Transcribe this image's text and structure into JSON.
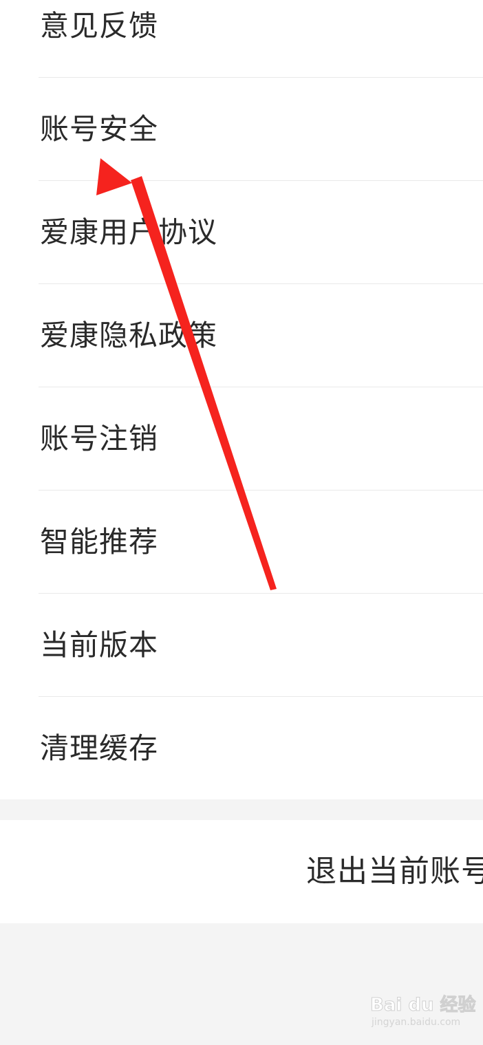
{
  "settings": {
    "items": [
      {
        "label": "意见反馈"
      },
      {
        "label": "账号安全"
      },
      {
        "label": "爱康用户协议"
      },
      {
        "label": "爱康隐私政策"
      },
      {
        "label": "账号注销"
      },
      {
        "label": "智能推荐"
      },
      {
        "label": "当前版本"
      },
      {
        "label": "清理缓存"
      }
    ]
  },
  "logout": {
    "label": "退出当前账号"
  },
  "annotation": {
    "arrow_icon": "red-arrow-icon",
    "color": "#f5231e"
  },
  "watermark": {
    "logo": "Bai du 经验",
    "sub": "jingyan.baidu.com"
  },
  "colors": {
    "background": "#f5f5f5",
    "panel": "#ffffff",
    "text": "#2a2a2a",
    "divider": "#e9e9e9"
  }
}
